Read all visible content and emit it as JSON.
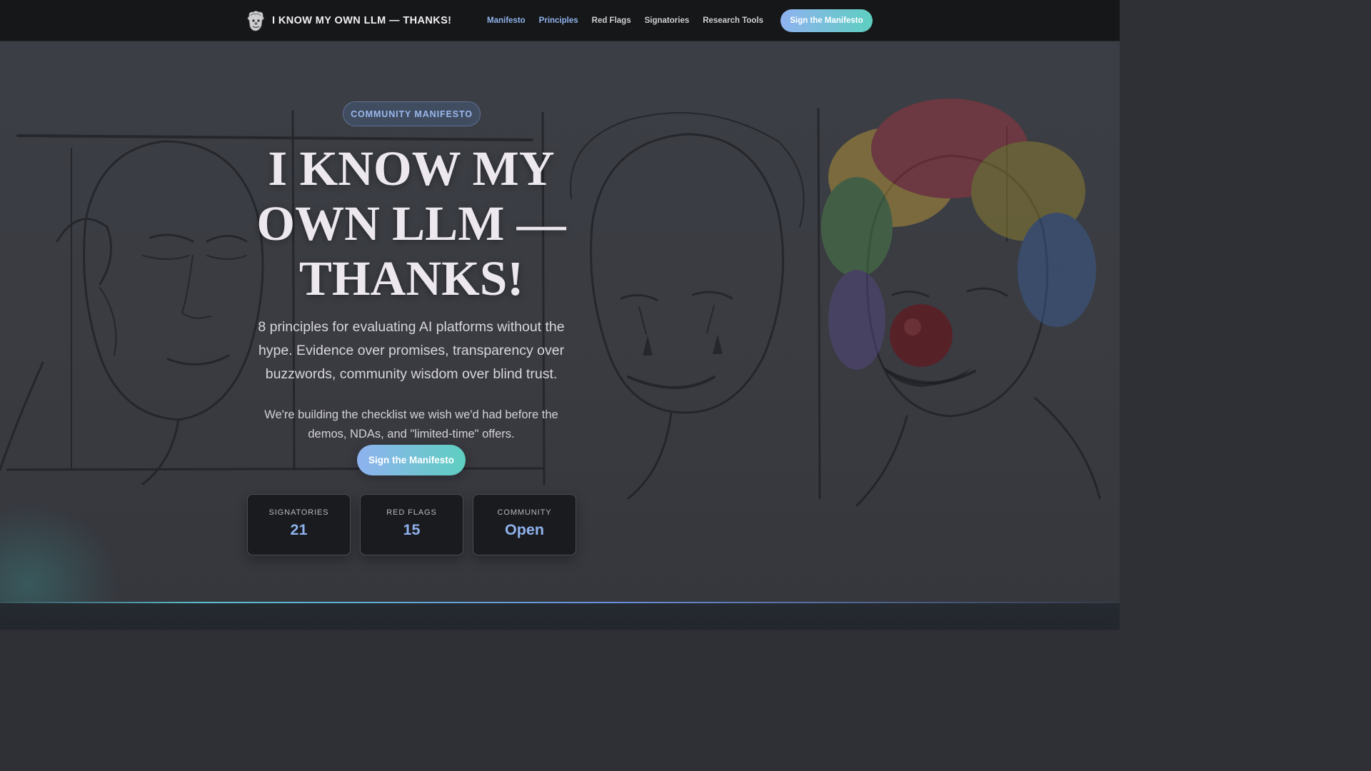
{
  "nav": {
    "brand": "I KNOW MY OWN LLM — THANKS!",
    "logo_icon": "clown-face-icon",
    "links": [
      {
        "label": "Manifesto",
        "active": true
      },
      {
        "label": "Principles",
        "active": true
      },
      {
        "label": "Red Flags",
        "active": false
      },
      {
        "label": "Signatories",
        "active": false
      },
      {
        "label": "Research Tools",
        "active": false
      }
    ],
    "cta": "Sign the Manifesto"
  },
  "hero": {
    "badge": "COMMUNITY MANIFESTO",
    "title": "I KNOW MY OWN LLM — THANKS!",
    "subtitle": "8 principles for evaluating AI platforms without the hype. Evidence over promises, transparency over buzzwords, community wisdom over blind trust.",
    "note": "We're building the checklist we wish we'd had before the demos, NDAs, and \"limited-time\" offers.",
    "cta": "Sign the Manifesto",
    "background_art": "sketch-faces-to-clown-illustration",
    "stats": [
      {
        "label": "SIGNATORIES",
        "value": "21"
      },
      {
        "label": "RED FLAGS",
        "value": "15"
      },
      {
        "label": "COMMUNITY",
        "value": "Open"
      }
    ]
  },
  "colors": {
    "accent": "#8fb2ec",
    "cta_gradient_start": "#8fb2f0",
    "cta_gradient_end": "#5ecfc0",
    "nav_bg": "#161718"
  }
}
